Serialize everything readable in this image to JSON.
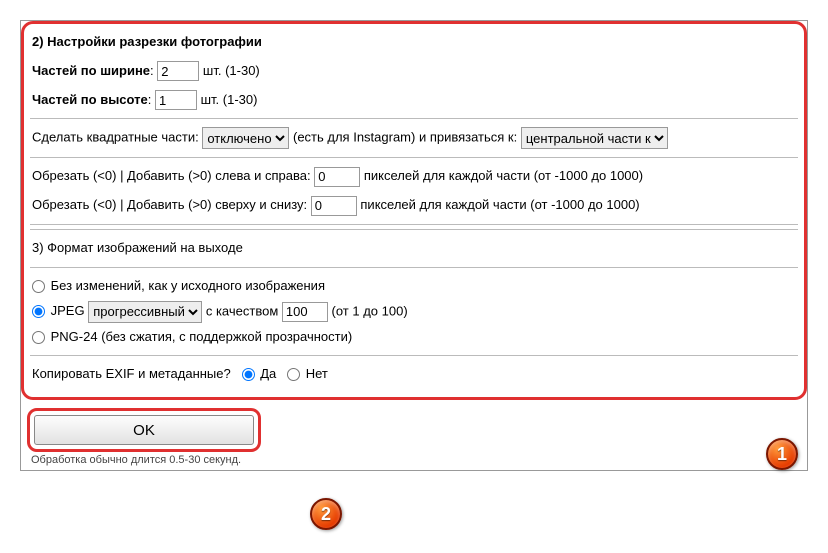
{
  "section2": {
    "title": "2) Настройки разрезки фотографии",
    "widthLabel": "Частей по ширине",
    "widthValue": "2",
    "widthUnit": "шт. (1-30)",
    "heightLabel": "Частей по высоте",
    "heightValue": "1",
    "heightUnit": "шт. (1-30)",
    "squareLabel": "Сделать квадратные части:",
    "squareSelected": "отключено",
    "squareAfter": "(есть для Instagram) и привязаться к:",
    "anchorSelected": "центральной части к",
    "cropLR_label": "Обрезать (<0) | Добавить (>0) слева и справа:",
    "cropLR_value": "0",
    "cropLR_after": "пикселей для каждой части (от -1000 до 1000)",
    "cropTB_label": "Обрезать (<0) | Добавить (>0) сверху и снизу:",
    "cropTB_value": "0",
    "cropTB_after": "пикселей для каждой части (от -1000 до 1000)"
  },
  "section3": {
    "title": "3) Формат изображений на выходе",
    "opt1": "Без изменений, как у исходного изображения",
    "opt2_prefix": "JPEG",
    "opt2_select": "прогрессивный",
    "opt2_mid": "с качеством",
    "opt2_value": "100",
    "opt2_after": "(от 1 до 100)",
    "opt3": "PNG-24 (без сжатия, с поддержкой прозрачности)",
    "exifLabel": "Копировать EXIF и метаданные?",
    "yes": "Да",
    "no": "Нет"
  },
  "ok": {
    "button": "OK",
    "hint": "Обработка обычно длится 0.5-30 секунд."
  },
  "badges": {
    "one": "1",
    "two": "2"
  }
}
